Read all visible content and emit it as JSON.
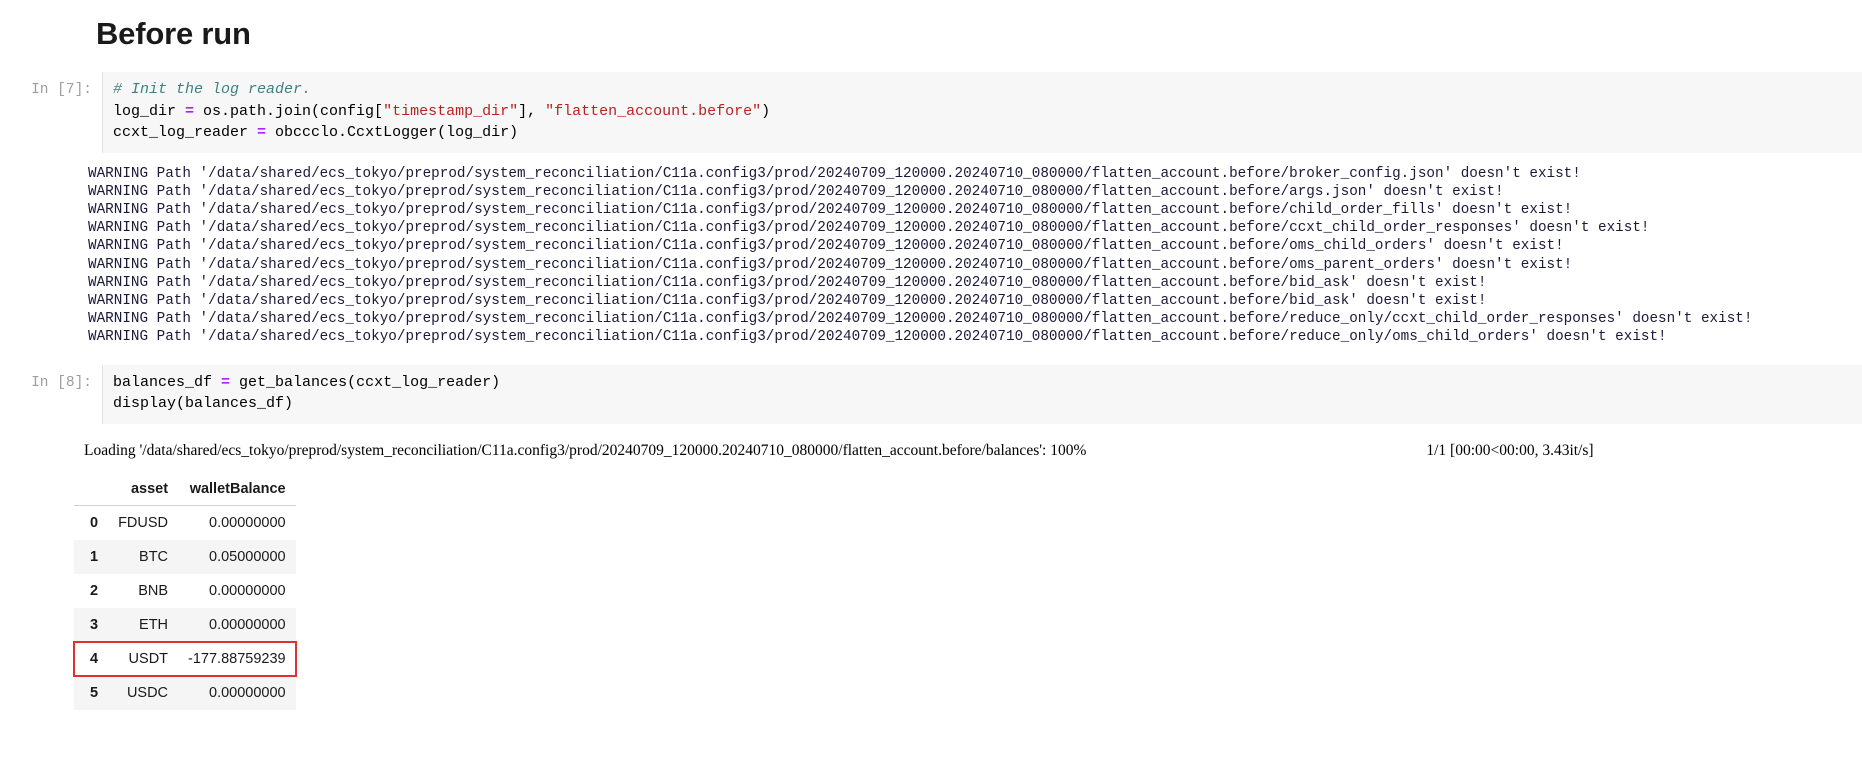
{
  "notebook": {
    "heading": "Before run",
    "cells": [
      {
        "prompt": "In [7]:",
        "code": [
          [
            {
              "t": "comment",
              "s": "# Init the log reader."
            }
          ],
          [
            {
              "t": "plain",
              "s": "log_dir "
            },
            {
              "t": "op",
              "s": "="
            },
            {
              "t": "plain",
              "s": " os.path.join(config["
            },
            {
              "t": "string",
              "s": "\"timestamp_dir\""
            },
            {
              "t": "plain",
              "s": "], "
            },
            {
              "t": "string",
              "s": "\"flatten_account.before\""
            },
            {
              "t": "plain",
              "s": ")"
            }
          ],
          [
            {
              "t": "plain",
              "s": "ccxt_log_reader "
            },
            {
              "t": "op",
              "s": "="
            },
            {
              "t": "plain",
              "s": " obccclo.CcxtLogger(log_dir)"
            }
          ]
        ]
      },
      {
        "prompt": "In [8]:",
        "code": [
          [
            {
              "t": "plain",
              "s": "balances_df "
            },
            {
              "t": "op",
              "s": "="
            },
            {
              "t": "plain",
              "s": " get_balances(ccxt_log_reader)"
            }
          ],
          [
            {
              "t": "plain",
              "s": "display(balances_df)"
            }
          ]
        ]
      }
    ],
    "warnings": [
      "WARNING Path '/data/shared/ecs_tokyo/preprod/system_reconciliation/C11a.config3/prod/20240709_120000.20240710_080000/flatten_account.before/broker_config.json' doesn't exist!",
      "WARNING Path '/data/shared/ecs_tokyo/preprod/system_reconciliation/C11a.config3/prod/20240709_120000.20240710_080000/flatten_account.before/args.json' doesn't exist!",
      "WARNING Path '/data/shared/ecs_tokyo/preprod/system_reconciliation/C11a.config3/prod/20240709_120000.20240710_080000/flatten_account.before/child_order_fills' doesn't exist!",
      "WARNING Path '/data/shared/ecs_tokyo/preprod/system_reconciliation/C11a.config3/prod/20240709_120000.20240710_080000/flatten_account.before/ccxt_child_order_responses' doesn't exist!",
      "WARNING Path '/data/shared/ecs_tokyo/preprod/system_reconciliation/C11a.config3/prod/20240709_120000.20240710_080000/flatten_account.before/oms_child_orders' doesn't exist!",
      "WARNING Path '/data/shared/ecs_tokyo/preprod/system_reconciliation/C11a.config3/prod/20240709_120000.20240710_080000/flatten_account.before/oms_parent_orders' doesn't exist!",
      "WARNING Path '/data/shared/ecs_tokyo/preprod/system_reconciliation/C11a.config3/prod/20240709_120000.20240710_080000/flatten_account.before/bid_ask' doesn't exist!",
      "WARNING Path '/data/shared/ecs_tokyo/preprod/system_reconciliation/C11a.config3/prod/20240709_120000.20240710_080000/flatten_account.before/bid_ask' doesn't exist!",
      "WARNING Path '/data/shared/ecs_tokyo/preprod/system_reconciliation/C11a.config3/prod/20240709_120000.20240710_080000/flatten_account.before/reduce_only/ccxt_child_order_responses' doesn't exist!",
      "WARNING Path '/data/shared/ecs_tokyo/preprod/system_reconciliation/C11a.config3/prod/20240709_120000.20240710_080000/flatten_account.before/reduce_only/oms_child_orders' doesn't exist!"
    ],
    "progress": {
      "label": "Loading '/data/shared/ecs_tokyo/preprod/system_reconciliation/C11a.config3/prod/20240709_120000.20240710_080000/flatten_account.before/balances': 100%",
      "percent": 100,
      "bar_color": "#3a8a3c",
      "stats": "1/1 [00:00<00:00, 3.43it/s]"
    },
    "dataframe": {
      "index_header": "",
      "columns": [
        "asset",
        "walletBalance"
      ],
      "rows": [
        {
          "index": "0",
          "asset": "FDUSD",
          "walletBalance": "0.00000000",
          "highlight": false
        },
        {
          "index": "1",
          "asset": "BTC",
          "walletBalance": "0.05000000",
          "highlight": false
        },
        {
          "index": "2",
          "asset": "BNB",
          "walletBalance": "0.00000000",
          "highlight": false
        },
        {
          "index": "3",
          "asset": "ETH",
          "walletBalance": "0.00000000",
          "highlight": false
        },
        {
          "index": "4",
          "asset": "USDT",
          "walletBalance": "-177.88759239",
          "highlight": true
        },
        {
          "index": "5",
          "asset": "USDC",
          "walletBalance": "0.00000000",
          "highlight": false
        }
      ],
      "highlight_color": "#e03030"
    }
  }
}
